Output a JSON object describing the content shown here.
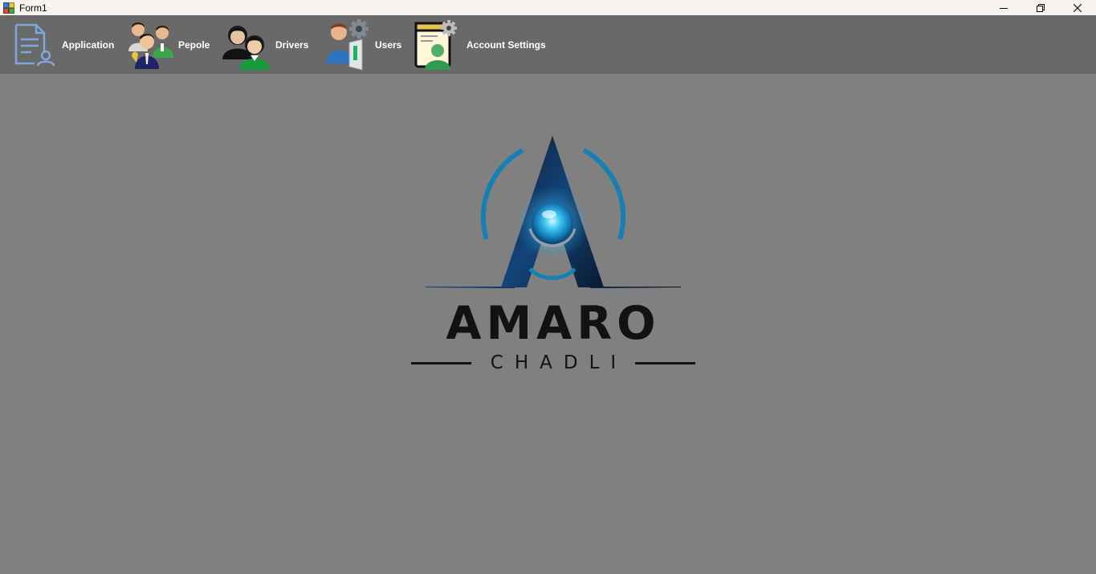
{
  "window": {
    "title": "Form1",
    "controls": [
      "minimize",
      "restore",
      "close"
    ]
  },
  "menu": {
    "items": [
      {
        "label": "Application",
        "icon": "application-form-icon"
      },
      {
        "label": "Pepole",
        "icon": "people-group-icon"
      },
      {
        "label": "Drivers",
        "icon": "drivers-icon"
      },
      {
        "label": "Users",
        "icon": "users-settings-icon"
      },
      {
        "label": "Account Settings",
        "icon": "account-settings-icon"
      }
    ]
  },
  "logo": {
    "word": "AMARO",
    "sub": "CHADLI",
    "accent_color": "#1b9fd6"
  },
  "colors": {
    "background": "#808080",
    "menustrip": "#696969",
    "titlebar": "#f7f3ef"
  }
}
